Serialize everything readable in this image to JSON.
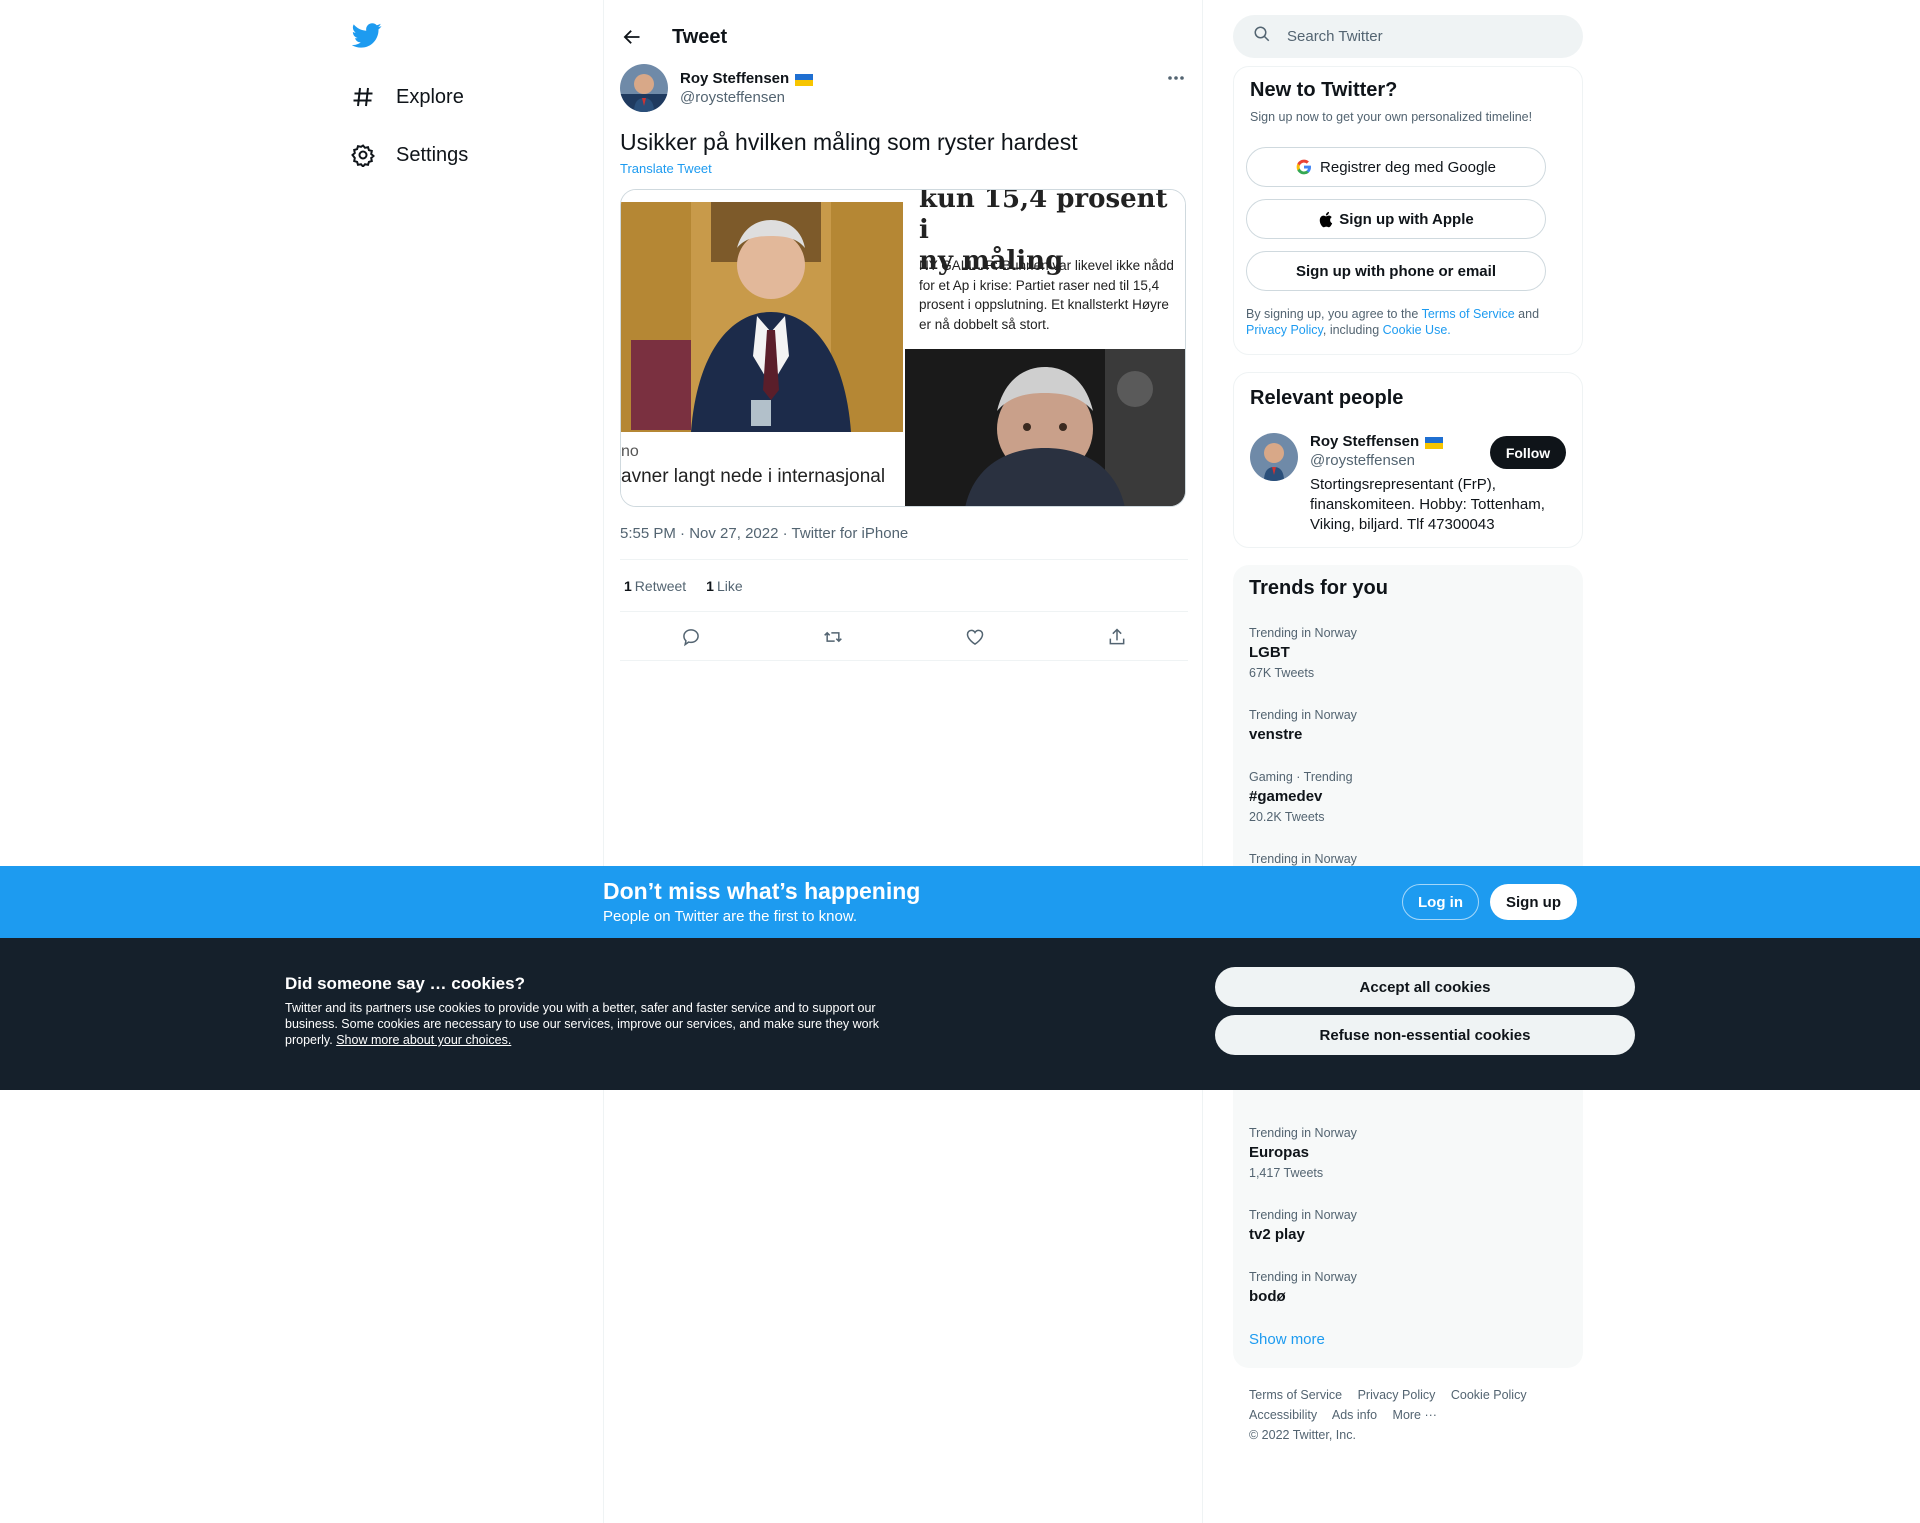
{
  "nav": {
    "items": [
      {
        "label": "Explore",
        "icon": "hashtag-icon"
      },
      {
        "label": "Settings",
        "icon": "gear-icon"
      }
    ]
  },
  "header": {
    "title": "Tweet"
  },
  "tweet": {
    "author_name": "Roy Steffensen",
    "author_handle": "@roysteffensen",
    "text": "Usikker på hvilken måling som ryster hardest",
    "translate_label": "Translate Tweet",
    "media": {
      "headline_line1": "kun 15,4 prosent i",
      "headline_line2": "ny måling",
      "body": "NY GALLUP: Bunnen var likevel ikke nådd for et Ap i krise: Partiet raser ned til 15,4 prosent i oppslutning. Et knallsterkt Høyre er nå dobbelt så stort.",
      "caption_small": "no",
      "caption_line": "avner langt nede i internasjonal"
    },
    "time": "5:55 PM",
    "date": "Nov 27, 2022",
    "source": "Twitter for iPhone",
    "retweets_count": "1",
    "retweets_label": "Retweet",
    "likes_count": "1",
    "likes_label": "Like"
  },
  "search": {
    "placeholder": "Search Twitter"
  },
  "new_to_twitter": {
    "title": "New to Twitter?",
    "subtitle": "Sign up now to get your own personalized timeline!",
    "google_label": "Registrer deg med Google",
    "apple_label": "Sign up with Apple",
    "phone_label": "Sign up with phone or email",
    "terms_prefix": "By signing up, you agree to the",
    "terms_link": "Terms of Service",
    "terms_and": "and",
    "privacy_link": "Privacy Policy",
    "including": ", including",
    "cookie_link": "Cookie Use."
  },
  "relevant_people": {
    "title": "Relevant people",
    "name": "Roy Steffensen",
    "handle": "@roysteffensen",
    "bio": "Stortingsrepresentant (FrP), finanskomiteen. Hobby: Tottenham, Viking, biljard. Tlf 47300043",
    "follow_label": "Follow"
  },
  "trends": {
    "title": "Trends for you",
    "items": [
      {
        "context": "Trending in Norway",
        "name": "LGBT",
        "count": "67K Tweets"
      },
      {
        "context": "Trending in Norway",
        "name": "venstre",
        "count": ""
      },
      {
        "context": "Gaming · Trending",
        "name": "#gamedev",
        "count": "20.2K Tweets"
      },
      {
        "context": "Trending in Norway",
        "name": "",
        "count": ""
      },
      {
        "context": "",
        "name": "",
        "count": ""
      },
      {
        "context": "Trending in Norway",
        "name": "Europas",
        "count": "1,417 Tweets"
      },
      {
        "context": "Trending in Norway",
        "name": "tv2 play",
        "count": ""
      },
      {
        "context": "Trending in Norway",
        "name": "bodø",
        "count": ""
      }
    ],
    "show_more": "Show more"
  },
  "footer": {
    "links": [
      "Terms of Service",
      "Privacy Policy",
      "Cookie Policy",
      "Accessibility",
      "Ads info",
      "More ···"
    ],
    "copyright": "© 2022 Twitter, Inc."
  },
  "promo": {
    "title": "Don’t miss what’s happening",
    "subtitle": "People on Twitter are the first to know.",
    "login_label": "Log in",
    "signup_label": "Sign up"
  },
  "cookies": {
    "title": "Did someone say … cookies?",
    "text": "Twitter and its partners use cookies to provide you with a better, safer and faster service and to support our business. Some cookies are necessary to use our services, improve our services, and make sure they work properly.",
    "link": "Show more about your choices.",
    "accept_label": "Accept all cookies",
    "refuse_label": "Refuse non-essential cookies"
  },
  "colors": {
    "brand_blue": "#1d9bf0",
    "text_primary": "#0f1419",
    "text_secondary": "#536471",
    "cookie_bg": "#15202b"
  }
}
